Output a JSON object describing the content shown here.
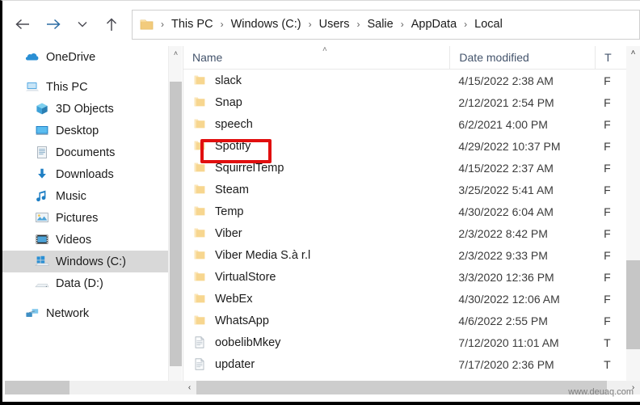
{
  "nav": {
    "back": "←",
    "forward": "→",
    "recent": "˅",
    "up": "↑"
  },
  "breadcrumb": {
    "separator": "›",
    "items": [
      "This PC",
      "Windows (C:)",
      "Users",
      "Salie",
      "AppData",
      "Local"
    ]
  },
  "sidebar": {
    "items": [
      {
        "label": "OneDrive",
        "icon": "onedrive-cloud-icon",
        "indent": false,
        "selected": false
      },
      {
        "label": "This PC",
        "icon": "this-pc-icon",
        "indent": false,
        "selected": false
      },
      {
        "label": "3D Objects",
        "icon": "3d-objects-icon",
        "indent": true,
        "selected": false
      },
      {
        "label": "Desktop",
        "icon": "desktop-icon",
        "indent": true,
        "selected": false
      },
      {
        "label": "Documents",
        "icon": "documents-icon",
        "indent": true,
        "selected": false
      },
      {
        "label": "Downloads",
        "icon": "downloads-icon",
        "indent": true,
        "selected": false
      },
      {
        "label": "Music",
        "icon": "music-icon",
        "indent": true,
        "selected": false
      },
      {
        "label": "Pictures",
        "icon": "pictures-icon",
        "indent": true,
        "selected": false
      },
      {
        "label": "Videos",
        "icon": "videos-icon",
        "indent": true,
        "selected": false
      },
      {
        "label": "Windows (C:)",
        "icon": "windows-drive-icon",
        "indent": true,
        "selected": true
      },
      {
        "label": "Data (D:)",
        "icon": "drive-icon",
        "indent": true,
        "selected": false
      },
      {
        "label": "Network",
        "icon": "network-icon",
        "indent": false,
        "selected": false
      }
    ]
  },
  "columns": {
    "name": "Name",
    "date_modified": "Date modified",
    "type": "T",
    "sort_indicator": "˄"
  },
  "files": [
    {
      "name": "slack",
      "date": "4/15/2022 2:38 AM",
      "type": "F",
      "icon": "folder-icon",
      "highlighted": false
    },
    {
      "name": "Snap",
      "date": "2/12/2021 2:54 PM",
      "type": "F",
      "icon": "folder-icon",
      "highlighted": false
    },
    {
      "name": "speech",
      "date": "6/2/2021 4:00 PM",
      "type": "F",
      "icon": "folder-icon",
      "highlighted": false
    },
    {
      "name": "Spotify",
      "date": "4/29/2022 10:37 PM",
      "type": "F",
      "icon": "folder-icon",
      "highlighted": true
    },
    {
      "name": "SquirrelTemp",
      "date": "4/15/2022 2:37 AM",
      "type": "F",
      "icon": "folder-icon",
      "highlighted": false
    },
    {
      "name": "Steam",
      "date": "3/25/2022 5:41 AM",
      "type": "F",
      "icon": "folder-icon",
      "highlighted": false
    },
    {
      "name": "Temp",
      "date": "4/30/2022 6:04 AM",
      "type": "F",
      "icon": "folder-icon",
      "highlighted": false
    },
    {
      "name": "Viber",
      "date": "2/3/2022 8:42 PM",
      "type": "F",
      "icon": "folder-icon",
      "highlighted": false
    },
    {
      "name": "Viber Media S.à r.l",
      "date": "2/3/2022 9:33 PM",
      "type": "F",
      "icon": "folder-icon",
      "highlighted": false
    },
    {
      "name": "VirtualStore",
      "date": "3/3/2020 12:36 PM",
      "type": "F",
      "icon": "folder-icon",
      "highlighted": false
    },
    {
      "name": "WebEx",
      "date": "4/30/2022 12:06 AM",
      "type": "F",
      "icon": "folder-icon",
      "highlighted": false
    },
    {
      "name": "WhatsApp",
      "date": "4/6/2022 2:55 PM",
      "type": "F",
      "icon": "folder-icon",
      "highlighted": false
    },
    {
      "name": "oobelibMkey",
      "date": "7/12/2020 11:01 AM",
      "type": "T",
      "icon": "document-icon",
      "highlighted": false
    },
    {
      "name": "updater",
      "date": "7/17/2020 2:36 PM",
      "type": "T",
      "icon": "document-icon",
      "highlighted": false
    }
  ],
  "scrollbars": {
    "up_arrow": "˄",
    "down_arrow": "˅",
    "left_arrow": "‹",
    "right_arrow": "›"
  },
  "watermark": {
    "text": "www.deuaq.com"
  },
  "colors": {
    "highlight_red": "#e10f0f",
    "selection_gray": "#d8d8d8",
    "header_text": "#44546c",
    "folder_yellow": "#f5ce79"
  }
}
